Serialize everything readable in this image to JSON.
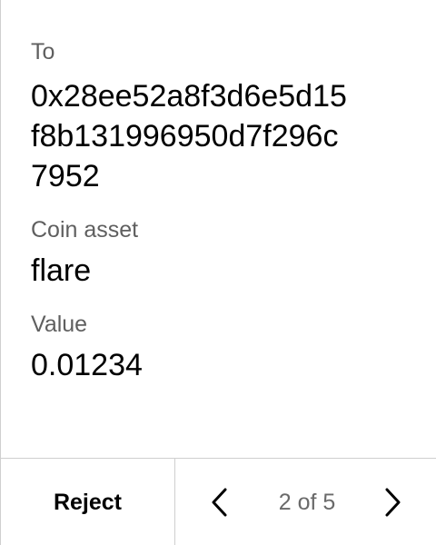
{
  "transaction": {
    "to": {
      "label": "To",
      "address_lines": [
        "0x28ee52a8f3d6e5d15",
        "f8b131996950d7f296c",
        "7952"
      ]
    },
    "coin_asset": {
      "label": "Coin asset",
      "value": "flare"
    },
    "value": {
      "label": "Value",
      "value": "0.01234"
    }
  },
  "footer": {
    "reject_label": "Reject",
    "pager": {
      "text": "2 of 5",
      "prev_icon": "chevron-left-icon",
      "next_icon": "chevron-right-icon"
    }
  },
  "colors": {
    "label": "#5f5f5f",
    "value": "#000000",
    "divider": "#cfcfcf",
    "pager_text": "#6a6a6a"
  }
}
